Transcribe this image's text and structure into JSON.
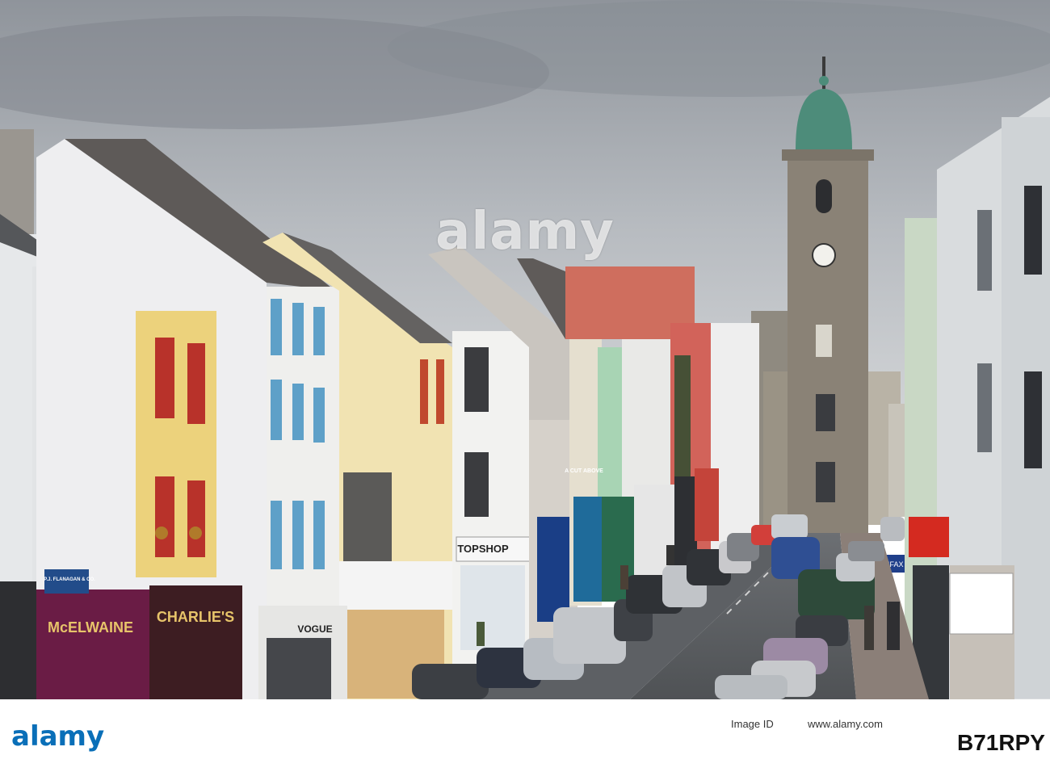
{
  "watermark": "alamy",
  "signs": {
    "flanagan": "P.J. FLANAGAN & CO.",
    "mcelwaine": "McELWAINE",
    "charlies": "CHARLIE'S",
    "vogue": "VOGUE",
    "topshop": "TOPSHOP",
    "cut_above": "A CUT ABOVE",
    "halifax": "HALIFAX"
  },
  "footer": {
    "logo": "alamy",
    "site": "www.alamy.com",
    "code": "B71RPY",
    "id_label": "Image ID"
  }
}
